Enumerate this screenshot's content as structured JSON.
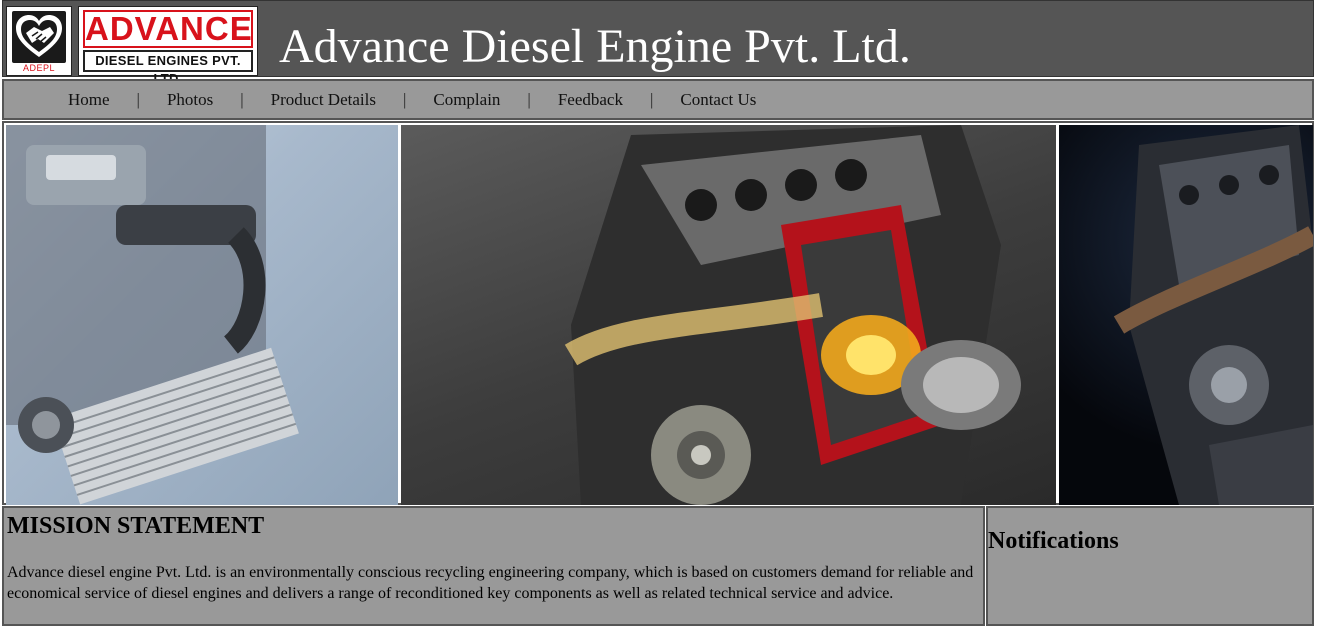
{
  "header": {
    "logo_icon_caption": "ADEPL",
    "logo_text_top": "ADVANCE",
    "logo_text_bottom": "DIESEL ENGINES PVT. LTD.",
    "site_title": "Advance Diesel Engine Pvt. Ltd."
  },
  "nav": {
    "items": [
      {
        "label": "Home"
      },
      {
        "label": "Photos"
      },
      {
        "label": "Product Details"
      },
      {
        "label": "Complain"
      },
      {
        "label": "Feedback"
      },
      {
        "label": "Contact Us"
      }
    ],
    "separator": "|"
  },
  "banner": {
    "panels": [
      "engine-photo-left",
      "engine-cutaway-photo",
      "engine-photo-right"
    ]
  },
  "mission": {
    "title": "MISSION STATEMENT",
    "text": "Advance diesel engine Pvt. Ltd. is an environmentally conscious recycling engineering company, which is based on customers demand for reliable and economical service of diesel engines and delivers a range of reconditioned key components as well as related technical service and advice."
  },
  "notifications": {
    "title": "Notifications"
  },
  "colors": {
    "header_bg": "#555555",
    "nav_bg": "#999999",
    "brand_red": "#d8121b"
  }
}
